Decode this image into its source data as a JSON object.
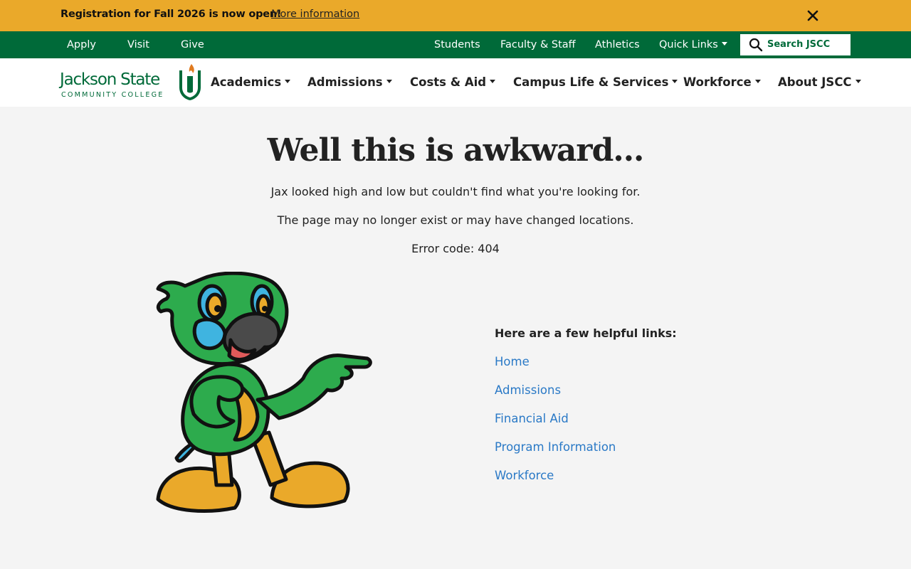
{
  "alert": {
    "message": "Registration for Fall 2026 is now open!",
    "link": "More information"
  },
  "utility": {
    "left_links": [
      "Apply",
      "Visit",
      "Give"
    ],
    "right_links": [
      "Students",
      "Faculty & Staff",
      "Athletics"
    ],
    "quick_links": "Quick Links",
    "search_label": "Search JSCC"
  },
  "logo": {
    "name": "Jackson State",
    "subtitle": "COMMUNITY COLLEGE"
  },
  "nav": {
    "items": [
      "Academics",
      "Admissions",
      "Costs & Aid",
      "Campus Life & Services",
      "Workforce",
      "About JSCC"
    ]
  },
  "content": {
    "heading": "Well this is awkward...",
    "line1": "Jax looked high and low but couldn't find what you're looking for.",
    "line2": "The page may no longer exist or may have changed locations.",
    "line3": "Error code: 404",
    "links_title": "Here are a few helpful links:",
    "links": [
      "Home",
      "Admissions",
      "Financial Aid",
      "Program Information",
      "Workforce"
    ]
  },
  "colors": {
    "alert_bg": "#eaa92a",
    "brand_green": "#006a39",
    "link_blue": "#2a79c6",
    "page_bg": "#f4f4f4"
  },
  "icons": [
    "close-icon",
    "search-icon",
    "chevron-down-icon",
    "torch-shield-icon",
    "parrot-mascot-image"
  ]
}
